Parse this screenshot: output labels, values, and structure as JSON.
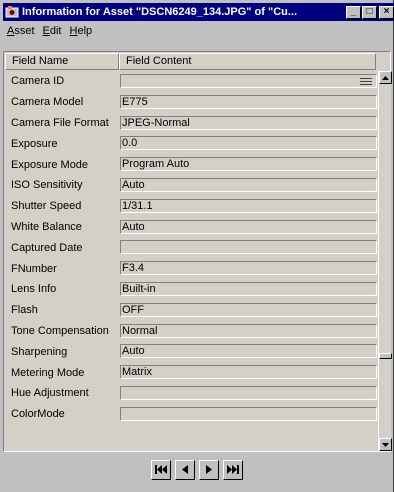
{
  "window": {
    "title": "Information for Asset \"DSCN6249_134.JPG\" of \"Cu...",
    "controls": {
      "minimize": "_",
      "maximize": "□",
      "close": "×"
    }
  },
  "menu": {
    "items": [
      {
        "label": "Asset",
        "accel": "A"
      },
      {
        "label": "Edit",
        "accel": "E"
      },
      {
        "label": "Help",
        "accel": "H"
      }
    ]
  },
  "table": {
    "headers": [
      "Field Name",
      "Field Content"
    ],
    "rows": [
      {
        "name": "Camera ID",
        "value": ""
      },
      {
        "name": "Camera Model",
        "value": "E775"
      },
      {
        "name": "Camera File Format",
        "value": "JPEG-Normal"
      },
      {
        "name": "Exposure",
        "value": "0.0"
      },
      {
        "name": "Exposure Mode",
        "value": "Program Auto"
      },
      {
        "name": "ISO Sensitivity",
        "value": "Auto"
      },
      {
        "name": "Shutter Speed",
        "value": "1/31.1"
      },
      {
        "name": "White Balance",
        "value": "Auto"
      },
      {
        "name": "Captured Date",
        "value": ""
      },
      {
        "name": "FNumber",
        "value": "F3.4"
      },
      {
        "name": "Lens Info",
        "value": "Built-in"
      },
      {
        "name": "Flash",
        "value": "OFF"
      },
      {
        "name": "Tone Compensation",
        "value": "Normal"
      },
      {
        "name": "Sharpening",
        "value": "Auto"
      },
      {
        "name": "Metering Mode",
        "value": "Matrix"
      },
      {
        "name": "Hue Adjustment",
        "value": ""
      },
      {
        "name": "ColorMode",
        "value": ""
      }
    ]
  },
  "navigation": {
    "buttons": [
      {
        "name": "first-record-button",
        "icon": "first-icon"
      },
      {
        "name": "previous-record-button",
        "icon": "previous-icon"
      },
      {
        "name": "next-record-button",
        "icon": "next-icon"
      },
      {
        "name": "last-record-button",
        "icon": "last-icon"
      }
    ]
  }
}
